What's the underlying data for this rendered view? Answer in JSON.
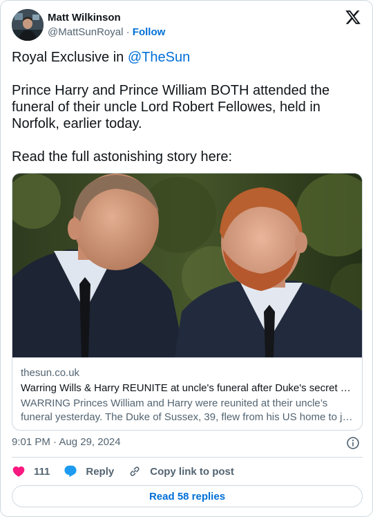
{
  "author": {
    "name": "Matt Wilkinson",
    "handle": "@MattSunRoyal",
    "separator": "·",
    "follow_label": "Follow"
  },
  "tweet": {
    "line1_prefix": "Royal Exclusive in ",
    "line1_mention": "@TheSun",
    "paragraph2": "Prince Harry and Prince William BOTH attended the funeral of their uncle Lord Robert Fellowes, held in Norfolk, earlier today.",
    "paragraph3": "Read the full astonishing story here:"
  },
  "link_card": {
    "domain": "thesun.co.uk",
    "title": "Warring Wills & Harry REUNITE at uncle's funeral after Duke's secret d…",
    "description_line1": "WARRING Princes William and Harry were reunited at their uncle’s",
    "description_line2": "funeral yesterday. The Duke of Sussex, 39, flew from his US home to jo…"
  },
  "timestamp": "9:01 PM · Aug 29, 2024",
  "actions": {
    "likes": "111",
    "reply_label": "Reply",
    "copy_label": "Copy link to post"
  },
  "read_replies_label": "Read 58 replies",
  "colors": {
    "link_blue": "#006fd6",
    "heart_pink": "#f91880",
    "reply_blue": "#1d9bf0",
    "muted_text": "#536471",
    "border": "#cfd9de"
  }
}
